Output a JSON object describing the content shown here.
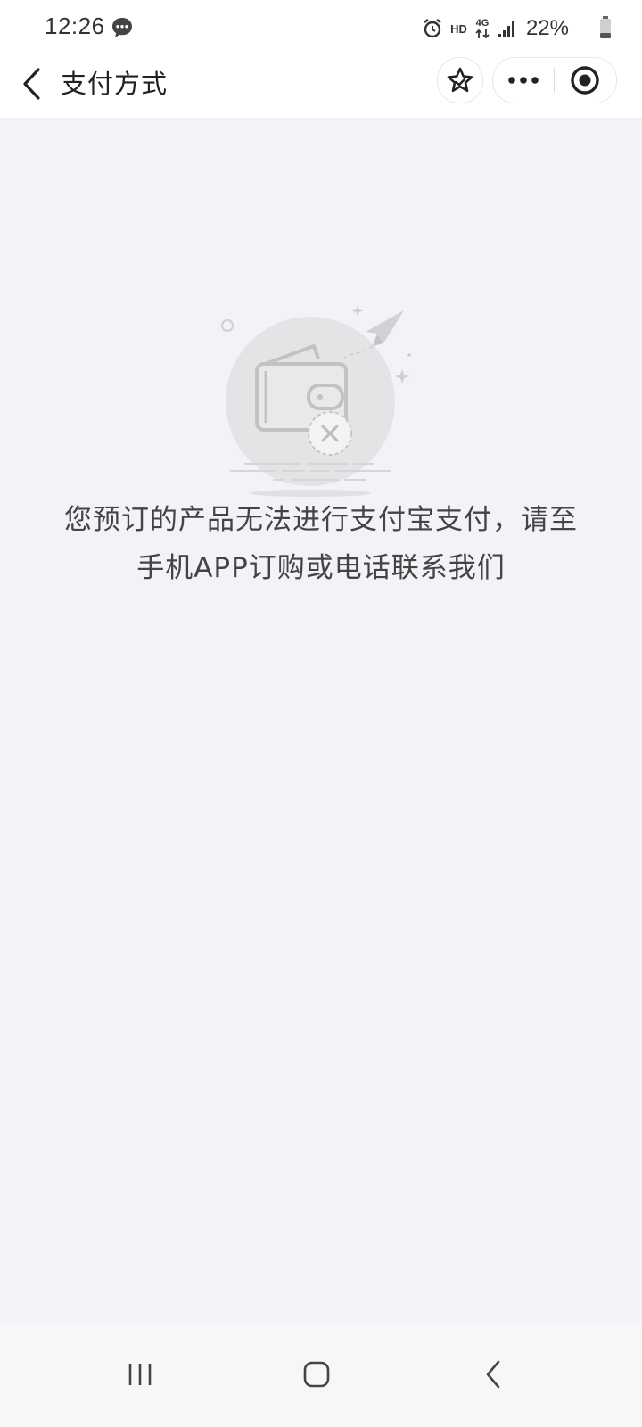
{
  "status_bar": {
    "time": "12:26",
    "hd_label": "HD",
    "network_label": "4G",
    "battery_percent": "22%",
    "icons": [
      "message-icon",
      "alarm-icon",
      "data-arrows-icon",
      "signal-icon",
      "battery-icon"
    ]
  },
  "nav": {
    "title": "支付方式",
    "back_icon": "chevron-left-icon",
    "star_icon": "star-icon",
    "more_icon": "more-dots-icon",
    "close_icon": "target-close-icon"
  },
  "main": {
    "illustration": "wallet-error-illustration",
    "message_line1": "您预订的产品无法进行支付宝支付，请至",
    "message_line2": "手机APP订购或电话联系我们"
  },
  "system_nav": {
    "recent_icon": "recent-apps-icon",
    "home_icon": "home-icon",
    "back_icon": "back-icon"
  },
  "colors": {
    "page_background": "#f2f3f7",
    "header_background": "#ffffff",
    "text_primary": "#333333",
    "illustration_gray": "#d8d8d8"
  }
}
